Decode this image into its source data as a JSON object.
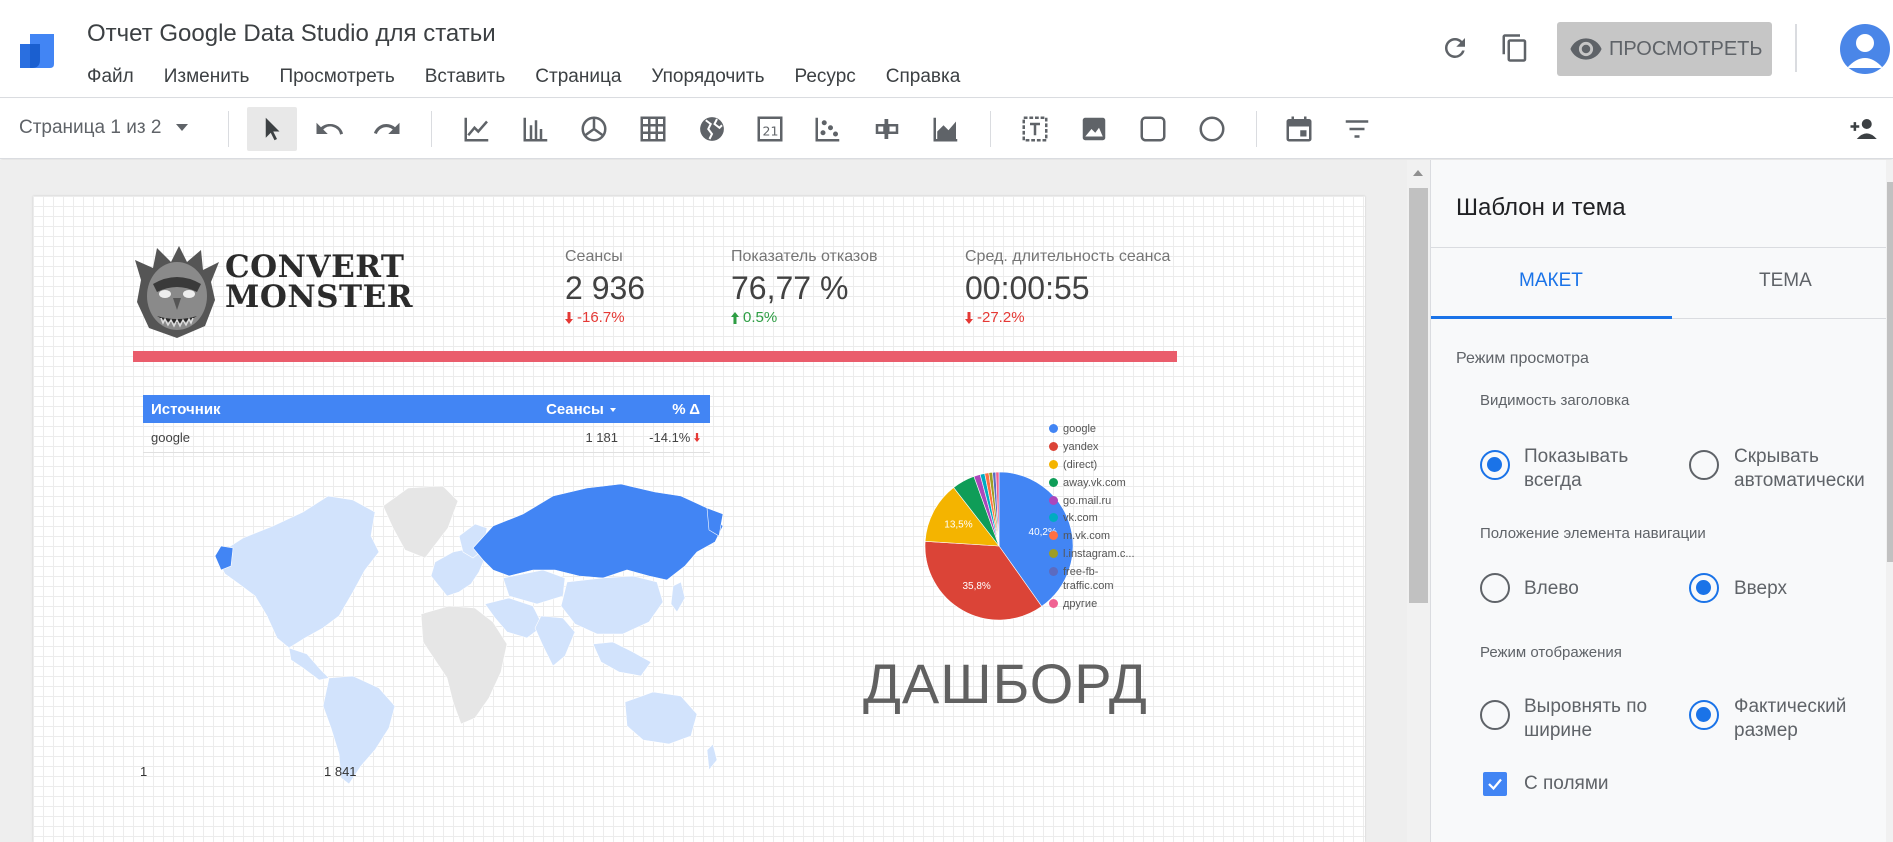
{
  "app": {
    "document_title": "Отчет Google Data Studio для статьи",
    "menu": [
      "Файл",
      "Изменить",
      "Просмотреть",
      "Вставить",
      "Страница",
      "Упорядочить",
      "Ресурс",
      "Справка"
    ],
    "view_button_label": "ПРОСМОТРЕТЬ"
  },
  "toolbar": {
    "page_selector": "Страница 1 из 2",
    "tools": [
      "select-tool",
      "undo",
      "redo",
      "time-series-chart",
      "bar-chart",
      "pie-chart",
      "table",
      "geo-map",
      "scorecard",
      "scatter-chart",
      "bullet-chart",
      "area-chart",
      "text",
      "image",
      "rectangle",
      "circle",
      "date-range",
      "filter-control",
      "add-person"
    ]
  },
  "report": {
    "brand": [
      "CONVERT",
      "MONSTER"
    ],
    "kpis": [
      {
        "label": "Сеансы",
        "value": "2 936",
        "delta": "-16.7%",
        "direction": "down"
      },
      {
        "label": "Показатель отказов",
        "value": "76,77 %",
        "delta": "0.5%",
        "direction": "up"
      },
      {
        "label": "Сред. длительность сеанса",
        "value": "00:00:55",
        "delta": "-27.2%",
        "direction": "down"
      }
    ],
    "table": {
      "headers": [
        "Источник",
        "Сеансы",
        "% Δ"
      ],
      "rows": [
        {
          "source": "google",
          "sessions": "1 181",
          "change": "-14.1%"
        }
      ]
    },
    "map": {
      "legend_min": "1",
      "legend_max": "1 841",
      "colors": {
        "high": "#4285f4",
        "low": "#d2e3fc",
        "none": "#e6e6e6"
      }
    },
    "dashboard_title": "ДАШБОРД"
  },
  "chart_data": {
    "type": "pie",
    "categories": [
      "google",
      "yandex",
      "(direct)",
      "away.vk.com",
      "go.mail.ru",
      "vk.com",
      "m.vk.com",
      "l.instagram.c...",
      "free-fb-traffic.com",
      "другие"
    ],
    "values": [
      40.2,
      35.8,
      13.5,
      5.0,
      1.4,
      1.0,
      0.9,
      0.8,
      0.7,
      0.7
    ],
    "data_labels": [
      "40,2%",
      "35,8%",
      "13,5%"
    ],
    "colors": [
      "#4285f4",
      "#db4437",
      "#f4b400",
      "#0f9d58",
      "#ab47bc",
      "#00acc1",
      "#ff7043",
      "#9e9d24",
      "#5c6bc0",
      "#f06292"
    ],
    "legend_position": "right"
  },
  "panel": {
    "title": "Шаблон и тема",
    "tabs": [
      "МАКЕТ",
      "ТЕМА"
    ],
    "view_mode_title": "Режим просмотра",
    "header_visibility_title": "Видимость заголовка",
    "show_always": "Показывать всегда",
    "hide_auto": "Скрывать автоматически",
    "nav_position_title": "Положение элемента навигации",
    "nav_left": "Влево",
    "nav_top": "Вверх",
    "display_mode_title": "Режим отображения",
    "fit_width": "Выровнять по ширине",
    "actual_size": "Фактический размер",
    "with_margins": "С полями"
  },
  "colors": {
    "accent": "#1a73e8",
    "table_header": "#4285f4",
    "bar": "#ea5d6c"
  }
}
